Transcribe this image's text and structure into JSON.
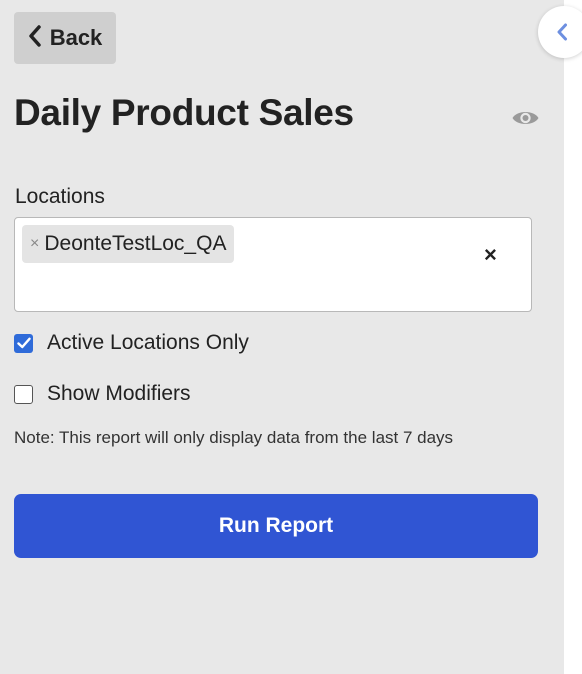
{
  "back_button": {
    "label": "Back",
    "icon": "chevron-left-icon"
  },
  "collapse_tab": {
    "icon": "chevron-left-icon",
    "color": "#6d8fe0"
  },
  "page": {
    "title": "Daily Product Sales",
    "visibility_icon": "eye-icon"
  },
  "locations": {
    "label": "Locations",
    "selected": [
      {
        "label": "DeonteTestLoc_QA",
        "remove_glyph": "×"
      }
    ],
    "clear_glyph": "×"
  },
  "options": {
    "active_locations": {
      "label": "Active Locations Only",
      "checked": true
    },
    "show_modifiers": {
      "label": "Show Modifiers",
      "checked": false
    }
  },
  "note": "Note: This report will only display data from the last 7 days",
  "run_button": {
    "label": "Run Report"
  },
  "colors": {
    "accent": "#3055d3",
    "checkbox": "#2f6bd9",
    "panel_bg": "#e8e8e8"
  }
}
